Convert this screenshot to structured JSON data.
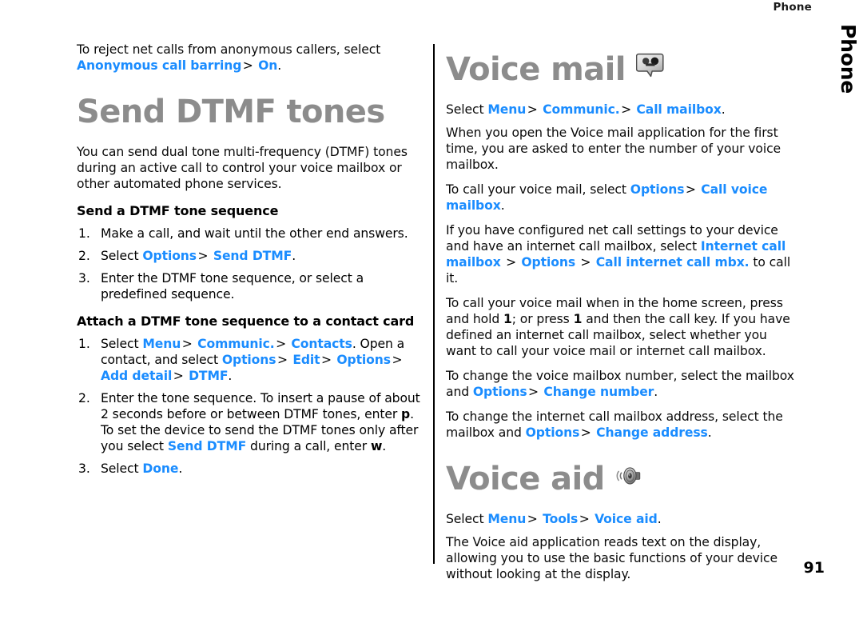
{
  "running_head": "Phone",
  "side_tab": "Phone",
  "page_number": "91",
  "colors": {
    "link": "#1a8cff",
    "heading": "#8c8c8c",
    "body": "#0a0a0a"
  },
  "left_column": {
    "intro_paragraph": {
      "lead": "To reject net calls from anonymous callers, select",
      "link_1": "Anonymous call barring",
      "sep_1": ">",
      "link_2": "On",
      "tail": "."
    },
    "heading": "Send DTMF tones",
    "body_paragraph": "You can send dual tone multi-frequency (DTMF) tones during an active call to control your voice mailbox or other automated phone services.",
    "subheading_1": "Send a DTMF tone sequence",
    "steps_1": [
      {
        "text": "Make a call, and wait until the other end answers."
      },
      {
        "lead": "Select ",
        "link_1": "Options",
        "sep_1": ">",
        "link_2": "Send DTMF",
        "tail": "."
      },
      {
        "text": "Enter the DTMF tone sequence, or select a predefined sequence."
      }
    ],
    "subheading_2": "Attach a DTMF tone sequence to a contact card",
    "steps_2": [
      {
        "lead": "Select ",
        "link_1": "Menu",
        "sep_1": ">",
        "link_2": "Communic.",
        "sep_2": ">",
        "link_3": "Contacts",
        "mid": ". Open a contact, and select ",
        "link_4": "Options",
        "sep_3": ">",
        "link_5": "Edit",
        "sep_4": ">",
        "link_6": "Options",
        "sep_5": ">",
        "link_7": "Add detail",
        "sep_6": ">",
        "link_8": "DTMF",
        "tail": "."
      },
      {
        "lead": "Enter the tone sequence. To insert a pause of about 2 seconds before or between DTMF tones, enter ",
        "kbd_1": "p",
        "mid": ". To set the device to send the DTMF tones only after you select ",
        "link_1": "Send DTMF",
        "mid_2": " during a call, enter ",
        "kbd_2": "w",
        "tail": "."
      },
      {
        "lead": "Select ",
        "link_1": "Done",
        "tail": "."
      }
    ]
  },
  "right_column": {
    "voice_mail": {
      "heading": "Voice mail",
      "icon": "voice-mail-bubble-icon",
      "path_line": {
        "lead": "Select ",
        "link_1": "Menu",
        "sep_1": ">",
        "link_2": "Communic.",
        "sep_2": ">",
        "link_3": "Call mailbox",
        "tail": "."
      },
      "para_1": "When you open the Voice mail application for the first time, you are asked to enter the number of your voice mailbox.",
      "para_2": {
        "lead": "To call your voice mail, select ",
        "link_1": "Options",
        "sep_1": ">",
        "link_2": "Call voice mailbox",
        "tail": "."
      },
      "para_3": {
        "lead": "If you have configured net call settings to your device and have an internet call mailbox, select ",
        "link_1": "Internet call mailbox",
        "sep_1": ">",
        "link_2": "Options",
        "sep_2": ">",
        "link_3": "Call internet call mbx.",
        "tail": " to call it."
      },
      "para_4": {
        "lead": "To call your voice mail when in the home screen, press and hold ",
        "kbd_1": "1",
        "mid": "; or press ",
        "kbd_2": "1",
        "tail": " and then the call key. If you have defined an internet call mailbox, select whether you want to call your voice mail or internet call mailbox."
      },
      "para_5": {
        "lead": "To change the voice mailbox number, select the mailbox and ",
        "link_1": "Options",
        "sep_1": ">",
        "link_2": "Change number",
        "tail": "."
      },
      "para_6": {
        "lead": "To change the internet call mailbox address, select the mailbox and ",
        "link_1": "Options",
        "sep_1": ">",
        "link_2": "Change address",
        "tail": "."
      }
    },
    "voice_aid": {
      "heading": "Voice aid",
      "icon": "loudspeaker-icon",
      "path_line": {
        "lead": "Select ",
        "link_1": "Menu",
        "sep_1": ">",
        "link_2": "Tools",
        "sep_2": ">",
        "link_3": "Voice aid",
        "tail": "."
      },
      "para_1": "The Voice aid application reads text on the display, allowing you to use the basic functions of your device without looking at the display."
    }
  }
}
